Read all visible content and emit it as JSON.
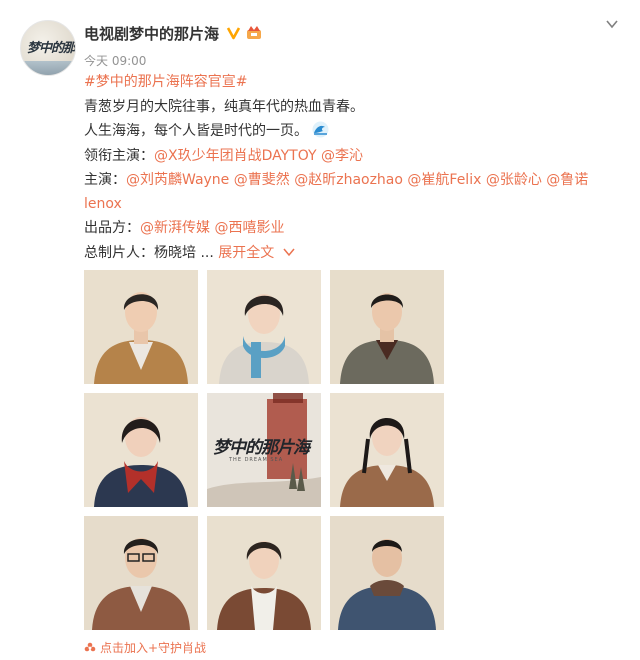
{
  "account": {
    "name": "电视剧梦中的那片海",
    "avatar_text": "梦中的那片海"
  },
  "post": {
    "time": "今天 09:00",
    "hashtag": "#梦中的那片海阵容官宣#",
    "line1": "青葱岁月的大院往事，纯真年代的热血青春。",
    "line2": "人生海海，每个人皆是时代的一页。",
    "lead_label": "领衔主演：",
    "lead_mentions": [
      "@X玖少年团肖战DAYTOY",
      "@李沁"
    ],
    "cast_label": "主演：",
    "cast_mentions": [
      "@刘芮麟Wayne",
      "@曹斐然",
      "@赵昕zhaozhao",
      "@崔航Felix",
      "@张龄心",
      "@鲁诺"
    ],
    "cast_overflow": "lenox",
    "producer_label": "出品方：",
    "producer_mentions": [
      "@新湃传媒",
      "@西嘻影业"
    ],
    "chief_label": "总制片人：杨晓培 ...",
    "expand_label": "展开全文"
  },
  "images": {
    "poster_title": "梦中的那片海",
    "poster_sub": "THE DREAM SEA"
  },
  "footer": {
    "text": "点击加入+守护肖战"
  },
  "icons": {
    "verified": "verified-badge-icon",
    "vip": "vip-crown-icon",
    "menu": "chevron-down-icon",
    "wave": "wave-emoji-icon",
    "footer": "heart-flower-icon"
  },
  "colors": {
    "link": "#eb7350",
    "text": "#333333",
    "muted": "#939393",
    "verified": "#ffa500"
  }
}
